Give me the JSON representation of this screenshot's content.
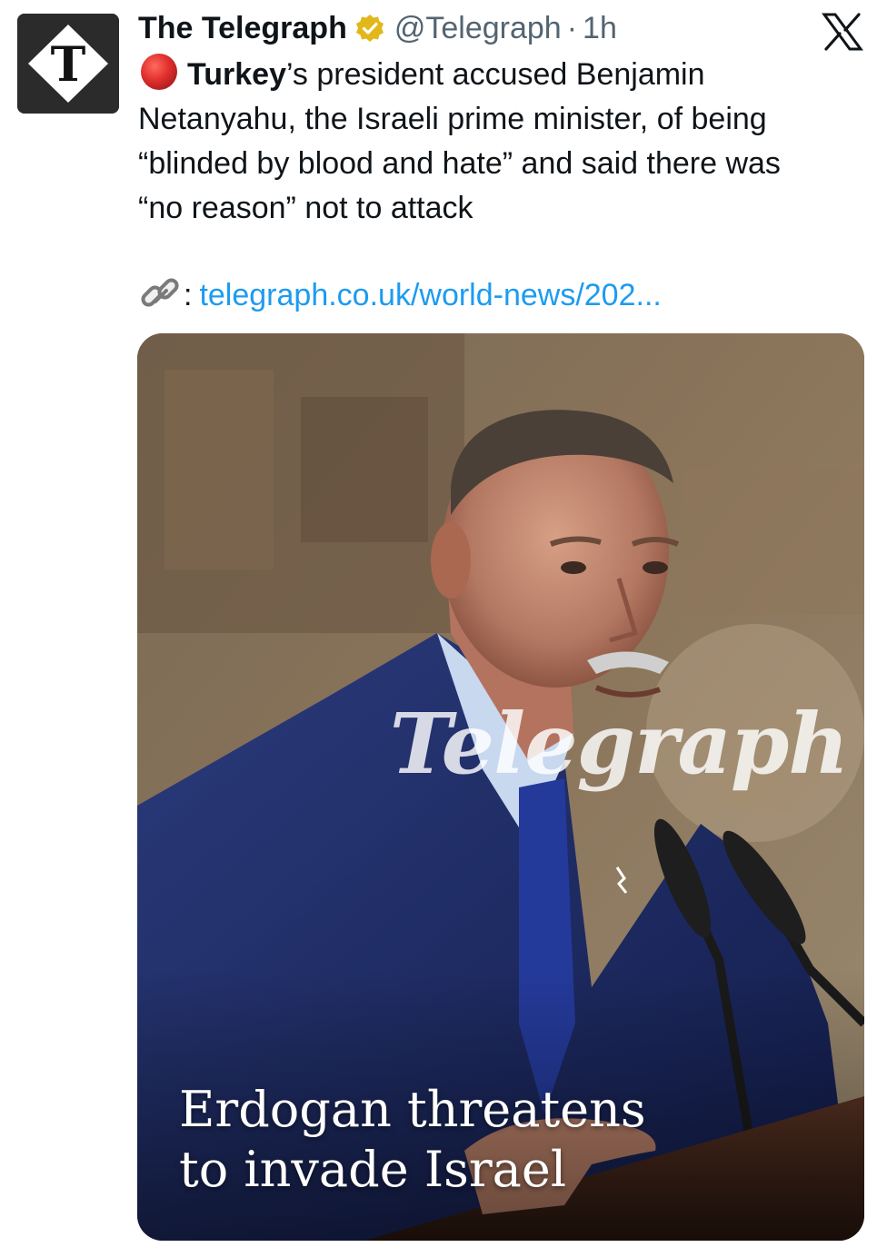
{
  "tweet": {
    "author_name": "The Telegraph",
    "handle": "@Telegraph",
    "separator": "·",
    "time": "1h",
    "body": {
      "line1_bold": "Turkey",
      "line1_rest": "’s president accused Benjamin",
      "line2": "Netanyahu, the Israeli prime minister, of being",
      "line3": "“blinded by blood and hate” and said there was",
      "line4": "“no reason” not to attack"
    },
    "link": {
      "colon": ":",
      "url": "telegraph.co.uk/world-news/202..."
    },
    "media": {
      "watermark": "Telegraph",
      "headline_line1": "Erdogan threatens",
      "headline_line2": "to invade Israel"
    }
  },
  "icons": {
    "avatar": "telegraph-t-logo-icon",
    "verified": "verified-badge-icon",
    "live": "red-circle-icon",
    "link": "link-icon",
    "platform": "x-logo-icon"
  },
  "colors": {
    "text": "#0f1419",
    "secondary": "#536471",
    "link": "#1d9bf0",
    "verified_gold": "#e2b719",
    "live_red": "#e0302e"
  }
}
